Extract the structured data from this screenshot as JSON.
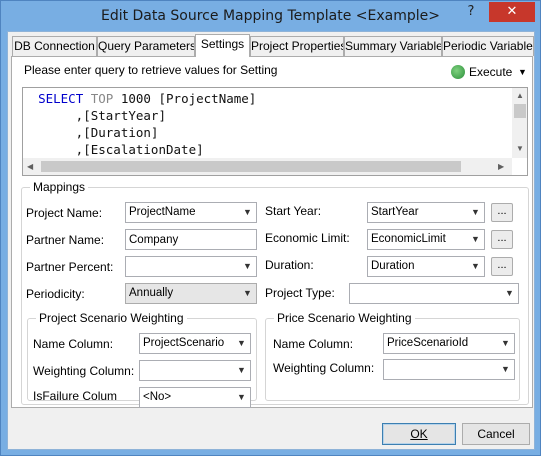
{
  "window": {
    "title": "Edit Data Source Mapping Template <Example>",
    "help_label": "?",
    "close_label": "✕"
  },
  "tabs": [
    {
      "label": "DB Connection"
    },
    {
      "label": "Query Parameters"
    },
    {
      "label": "Settings",
      "active": true
    },
    {
      "label": "Project Properties"
    },
    {
      "label": "Summary Variables"
    },
    {
      "label": "Periodic Variables"
    }
  ],
  "settings": {
    "prompt": "Please enter query to retrieve values for Setting",
    "execute_label": "Execute",
    "execute_caret": "▼",
    "query": {
      "line1": {
        "kw1": "SELECT",
        "kw2": "TOP",
        "num": "1000",
        "rest": " [ProjectName]"
      },
      "line2": "       ,[StartYear]",
      "line3": "       ,[Duration]",
      "line4": "       ,[EscalationDate]"
    }
  },
  "mappings": {
    "title": "Mappings",
    "project_name": {
      "label": "Project Name:",
      "value": "ProjectName"
    },
    "partner_name": {
      "label": "Partner Name:",
      "value": "Company"
    },
    "partner_percent": {
      "label": "Partner Percent:",
      "value": ""
    },
    "periodicity": {
      "label": "Periodicity:",
      "value": "Annually"
    },
    "start_year": {
      "label": "Start Year:",
      "value": "StartYear"
    },
    "economic_limit": {
      "label": "Economic Limit:",
      "value": "EconomicLimit"
    },
    "duration": {
      "label": "Duration:",
      "value": "Duration"
    },
    "project_type": {
      "label": "Project Type:",
      "value": ""
    },
    "ellipsis": "...",
    "project_scenario": {
      "title": "Project Scenario Weighting",
      "name_column": {
        "label": "Name Column:",
        "value": "ProjectScenario"
      },
      "weighting_column": {
        "label": "Weighting Column:",
        "value": ""
      },
      "is_failure": {
        "label": "IsFailure Colum",
        "value": "<No>"
      }
    },
    "price_scenario": {
      "title": "Price Scenario Weighting",
      "name_column": {
        "label": "Name Column:",
        "value": "PriceScenarioId"
      },
      "weighting_column": {
        "label": "Weighting Column:",
        "value": ""
      }
    }
  },
  "footer": {
    "ok_label": "OK",
    "cancel_label": "Cancel"
  }
}
